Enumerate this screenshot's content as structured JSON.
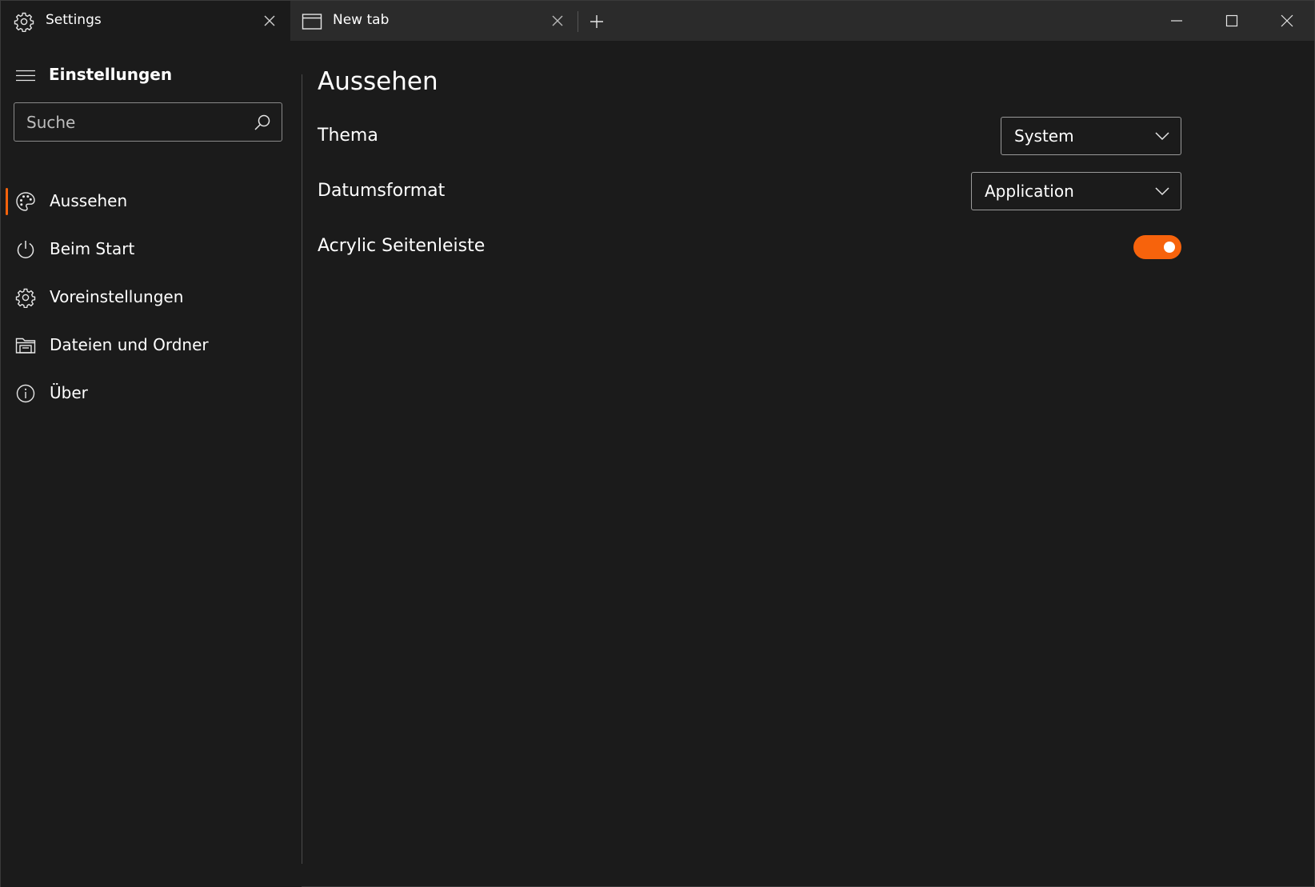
{
  "colors": {
    "accent": "#f7630c",
    "background": "#1b1b1b",
    "tabbar": "#2b2b2b",
    "text": "#ffffff"
  },
  "tabs": [
    {
      "label": "Settings",
      "icon": "gear-icon",
      "active": true
    },
    {
      "label": "New tab",
      "icon": "window-icon",
      "active": false
    }
  ],
  "sidebar": {
    "title": "Einstellungen",
    "search": {
      "placeholder": "Suche",
      "value": ""
    },
    "items": [
      {
        "label": "Aussehen",
        "icon": "palette-icon",
        "selected": true
      },
      {
        "label": "Beim Start",
        "icon": "power-icon",
        "selected": false
      },
      {
        "label": "Voreinstellungen",
        "icon": "gear-icon",
        "selected": false
      },
      {
        "label": "Dateien und Ordner",
        "icon": "folder-icon",
        "selected": false
      },
      {
        "label": "Über",
        "icon": "info-icon",
        "selected": false
      }
    ]
  },
  "main": {
    "title": "Aussehen",
    "settings": {
      "theme": {
        "label": "Thema",
        "value": "System"
      },
      "date_format": {
        "label": "Datumsformat",
        "value": "Application"
      },
      "acrylic_sidebar": {
        "label": "Acrylic Seitenleiste",
        "enabled": true
      }
    }
  }
}
